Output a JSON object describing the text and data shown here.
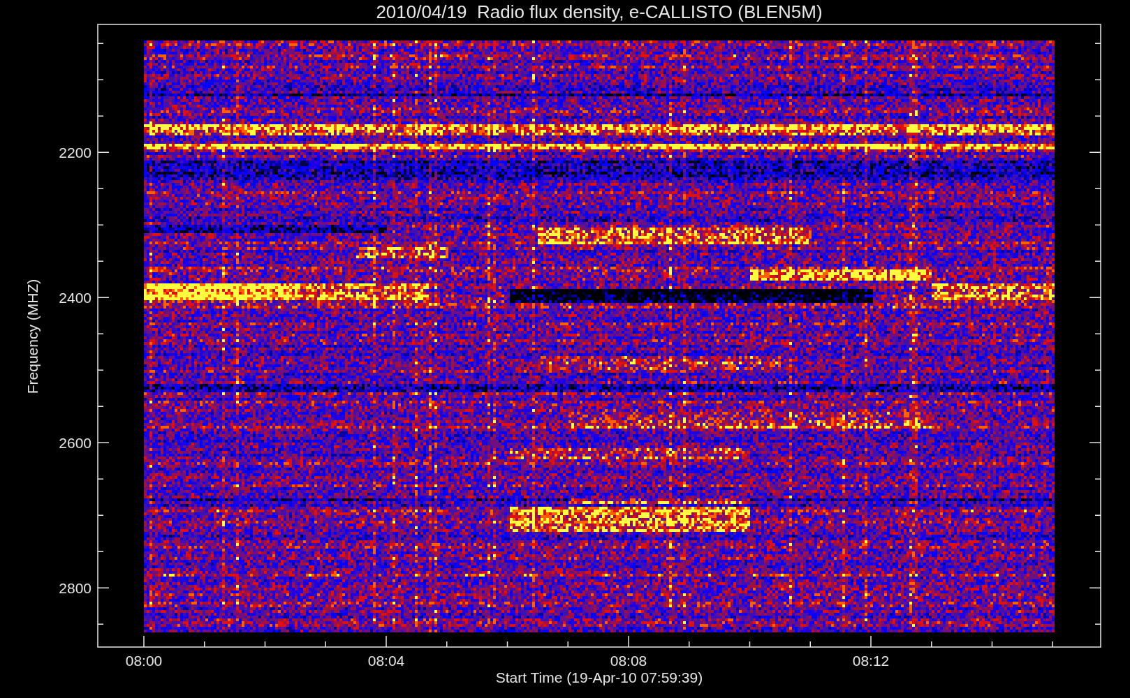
{
  "title": "2010/04/19  Radio flux density, e-CALLISTO (BLEN5M)",
  "y_axis": {
    "label": "Frequency (MHZ)",
    "ticks": [
      "2200",
      "2400",
      "2600",
      "2800"
    ]
  },
  "x_axis": {
    "label": "Start Time (19-Apr-10 07:59:39)",
    "ticks": [
      "08:00",
      "08:04",
      "08:08",
      "08:12"
    ]
  }
}
